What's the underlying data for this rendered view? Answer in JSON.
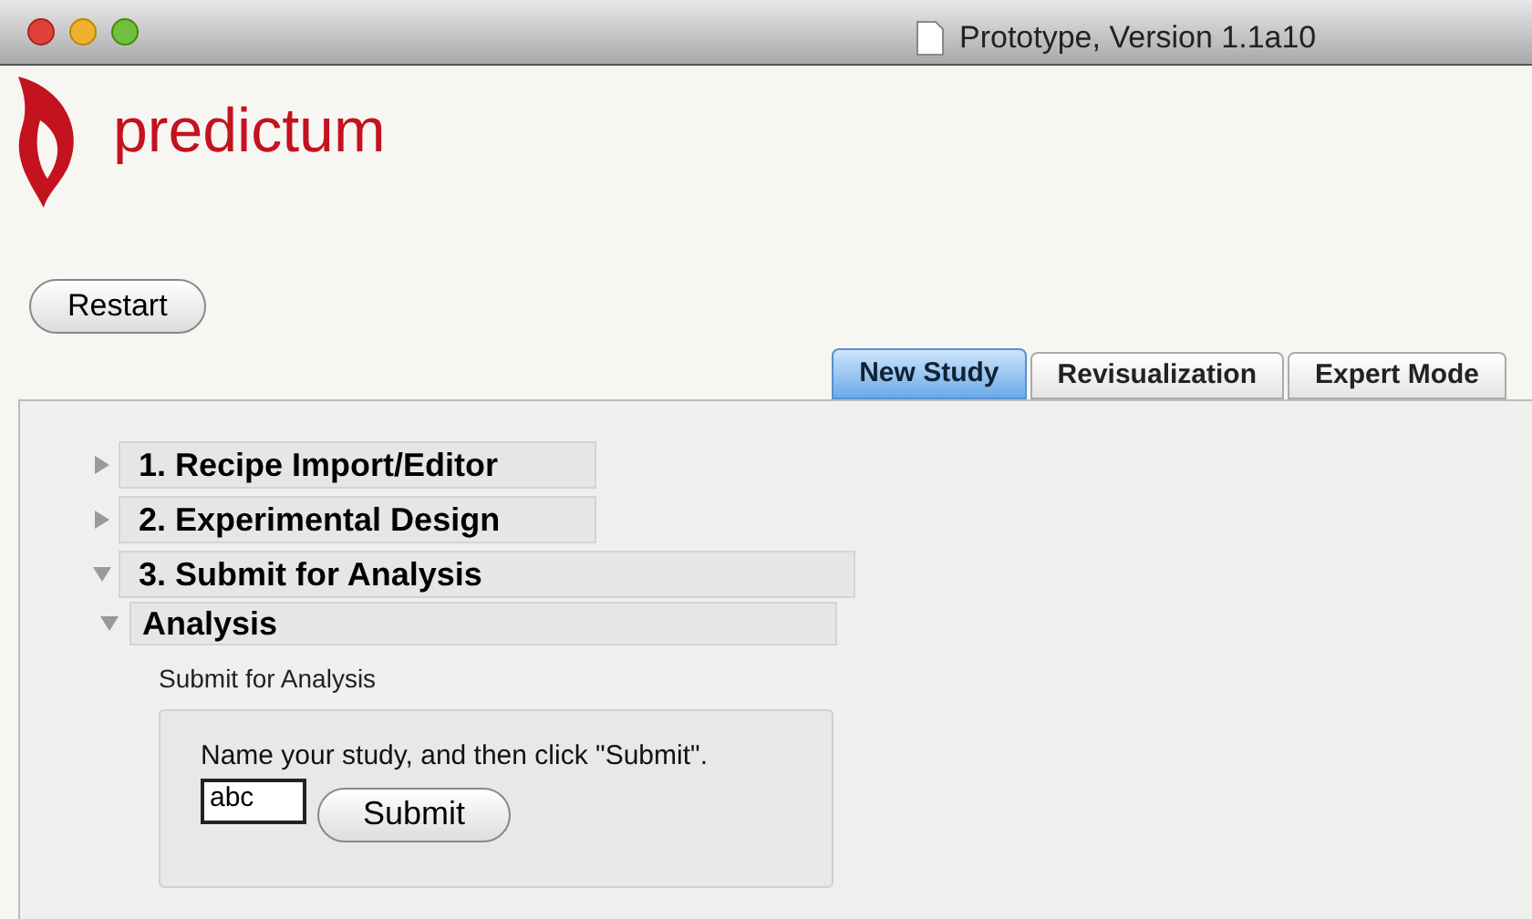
{
  "window": {
    "title": "Prototype, Version 1.1a10"
  },
  "logo": {
    "text": "predictum"
  },
  "restart_button": "Restart",
  "tabs": [
    {
      "label": "New Study",
      "selected": true
    },
    {
      "label": "Revisualization",
      "selected": false
    },
    {
      "label": "Expert Mode",
      "selected": false
    }
  ],
  "sections": [
    {
      "label": "1. Recipe Import/Editor",
      "expanded": false
    },
    {
      "label": "2. Experimental Design",
      "expanded": false
    },
    {
      "label": "3. Submit for Analysis",
      "expanded": true,
      "children": [
        {
          "label": "Analysis",
          "expanded": true,
          "subtitle": "Submit for Analysis",
          "form": {
            "instruction": "Name your study, and then click \"Submit\".",
            "name_field": {
              "value": "abc"
            },
            "submit_button": "Submit"
          }
        }
      ]
    }
  ]
}
